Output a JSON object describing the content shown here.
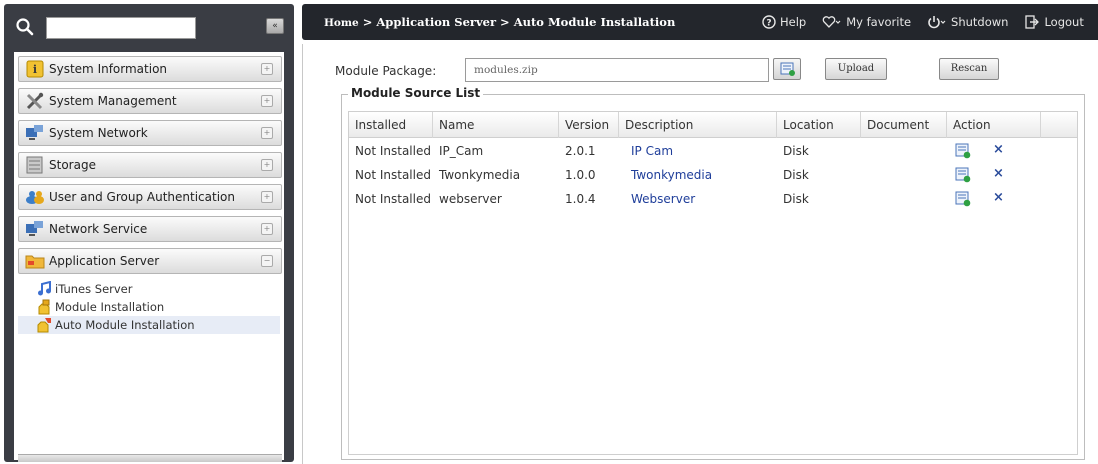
{
  "sidebar": {
    "search": {
      "value": "",
      "placeholder": ""
    },
    "collapse_label": "«",
    "items": [
      {
        "label": "System Information",
        "expand": "+"
      },
      {
        "label": "System Management",
        "expand": "+"
      },
      {
        "label": "System Network",
        "expand": "+"
      },
      {
        "label": "Storage",
        "expand": "+"
      },
      {
        "label": "User and Group Authentication",
        "expand": "+"
      },
      {
        "label": "Network Service",
        "expand": "+"
      },
      {
        "label": "Application Server",
        "expand": "−"
      }
    ],
    "subitems": [
      {
        "label": "iTunes Server",
        "active": false
      },
      {
        "label": "Module Installation",
        "active": false
      },
      {
        "label": "Auto Module Installation",
        "active": true
      }
    ]
  },
  "header": {
    "breadcrumb": {
      "home": "Home",
      "sep": " > ",
      "section": "Application Server",
      "page": "Auto Module Installation"
    },
    "links": {
      "help": "Help",
      "favorite": "My favorite",
      "shutdown": "Shutdown",
      "logout": "Logout"
    }
  },
  "main": {
    "package_label": "Module Package:",
    "package_value": "modules.zip",
    "upload_label": "Upload",
    "rescan_label": "Rescan",
    "legend": "Module Source List",
    "columns": [
      "Installed",
      "Name",
      "Version",
      "Description",
      "Location",
      "Document",
      "Action"
    ],
    "rows": [
      {
        "installed": "Not Installed",
        "name": "IP_Cam",
        "version": "2.0.1",
        "description": "IP Cam",
        "location": "Disk",
        "document": "",
        "delete": "×"
      },
      {
        "installed": "Not Installed",
        "name": "Twonkymedia",
        "version": "1.0.0",
        "description": "Twonkymedia",
        "location": "Disk",
        "document": "",
        "delete": "×"
      },
      {
        "installed": "Not Installed",
        "name": "webserver",
        "version": "1.0.4",
        "description": "Webserver",
        "location": "Disk",
        "document": "",
        "delete": "×"
      }
    ]
  },
  "colors": {
    "topbar": "#23262c",
    "sidebar_bg": "#3a3d44",
    "link": "#1f3e9a",
    "accent_gold": "#e6a81c"
  }
}
